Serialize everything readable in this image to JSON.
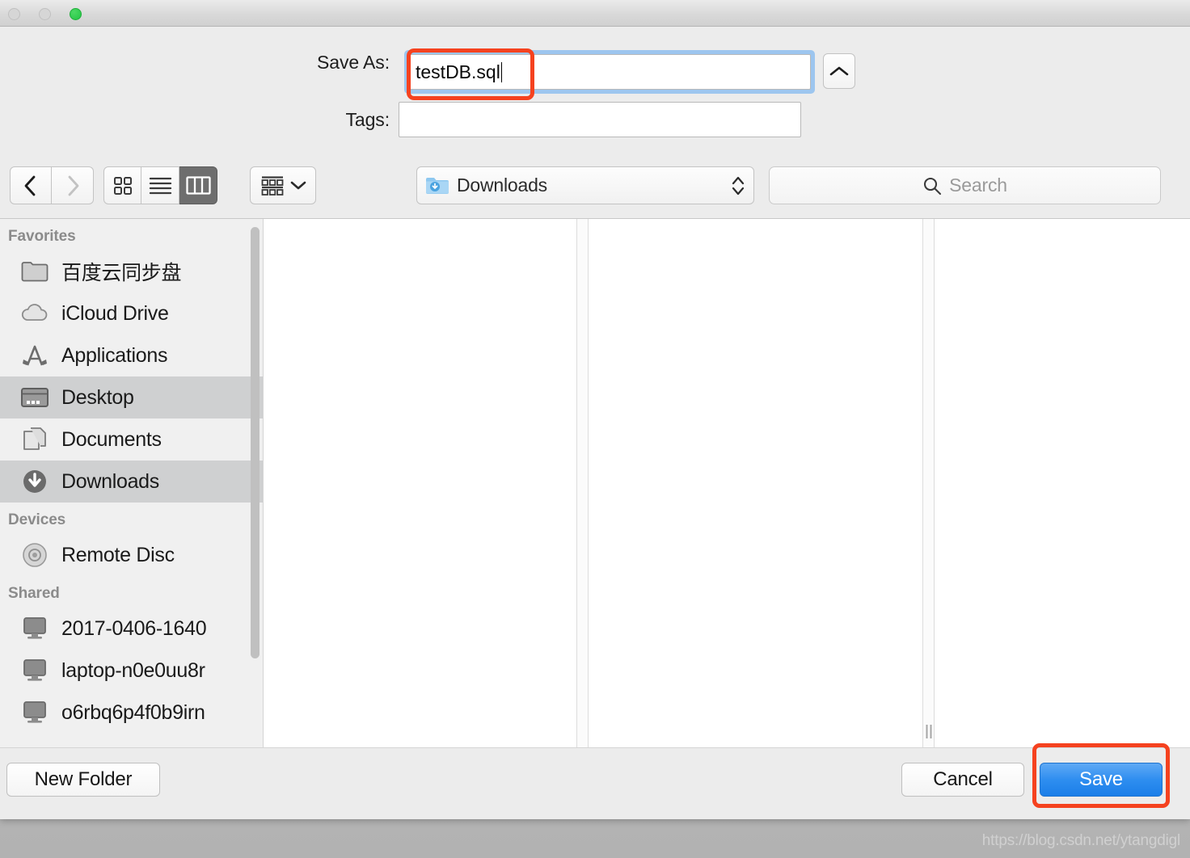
{
  "window": {
    "traffic_lights": [
      "close",
      "minimize",
      "zoom"
    ]
  },
  "form": {
    "save_as_label": "Save As:",
    "save_as_value": "testDB.sql",
    "tags_label": "Tags:",
    "tags_value": "",
    "collapse_icon": "chevron-up-icon"
  },
  "toolbar": {
    "back_icon": "chevron-left-icon",
    "forward_icon": "chevron-right-icon",
    "view_icon_grid": "icon-view-icon",
    "view_list": "list-view-icon",
    "view_columns": "column-view-icon",
    "view_selected": "column-view-icon",
    "arrange_icon": "arrange-grid-icon",
    "arrange_chevron": "chevron-down-icon",
    "path_icon": "downloads-folder-icon",
    "path_value": "Downloads",
    "path_stepper_icon": "stepper-updown-icon",
    "search_icon": "search-icon",
    "search_placeholder": "Search",
    "search_value": ""
  },
  "sidebar": {
    "sections": [
      {
        "title": "Favorites",
        "items": [
          {
            "label": "百度云同步盘",
            "icon": "folder-icon",
            "selected": false
          },
          {
            "label": "iCloud Drive",
            "icon": "cloud-icon",
            "selected": false
          },
          {
            "label": "Applications",
            "icon": "applications-icon",
            "selected": false
          },
          {
            "label": "Desktop",
            "icon": "desktop-icon",
            "selected": true
          },
          {
            "label": "Documents",
            "icon": "documents-icon",
            "selected": false
          },
          {
            "label": "Downloads",
            "icon": "downloads-icon",
            "selected": true
          }
        ]
      },
      {
        "title": "Devices",
        "items": [
          {
            "label": "Remote Disc",
            "icon": "disc-icon",
            "selected": false
          }
        ]
      },
      {
        "title": "Shared",
        "items": [
          {
            "label": "2017-0406-1640",
            "icon": "computer-icon",
            "selected": false
          },
          {
            "label": "laptop-n0e0uu8r",
            "icon": "computer-icon",
            "selected": false
          },
          {
            "label": "o6rbq6p4f0b9irn",
            "icon": "computer-icon",
            "selected": false
          }
        ]
      }
    ]
  },
  "footer": {
    "new_folder_label": "New Folder",
    "cancel_label": "Cancel",
    "save_label": "Save"
  },
  "annotations": {
    "color": "#f5421f",
    "targets": [
      "save-as-filename",
      "save-button"
    ]
  },
  "watermark": "https://blog.csdn.net/ytangdigl"
}
